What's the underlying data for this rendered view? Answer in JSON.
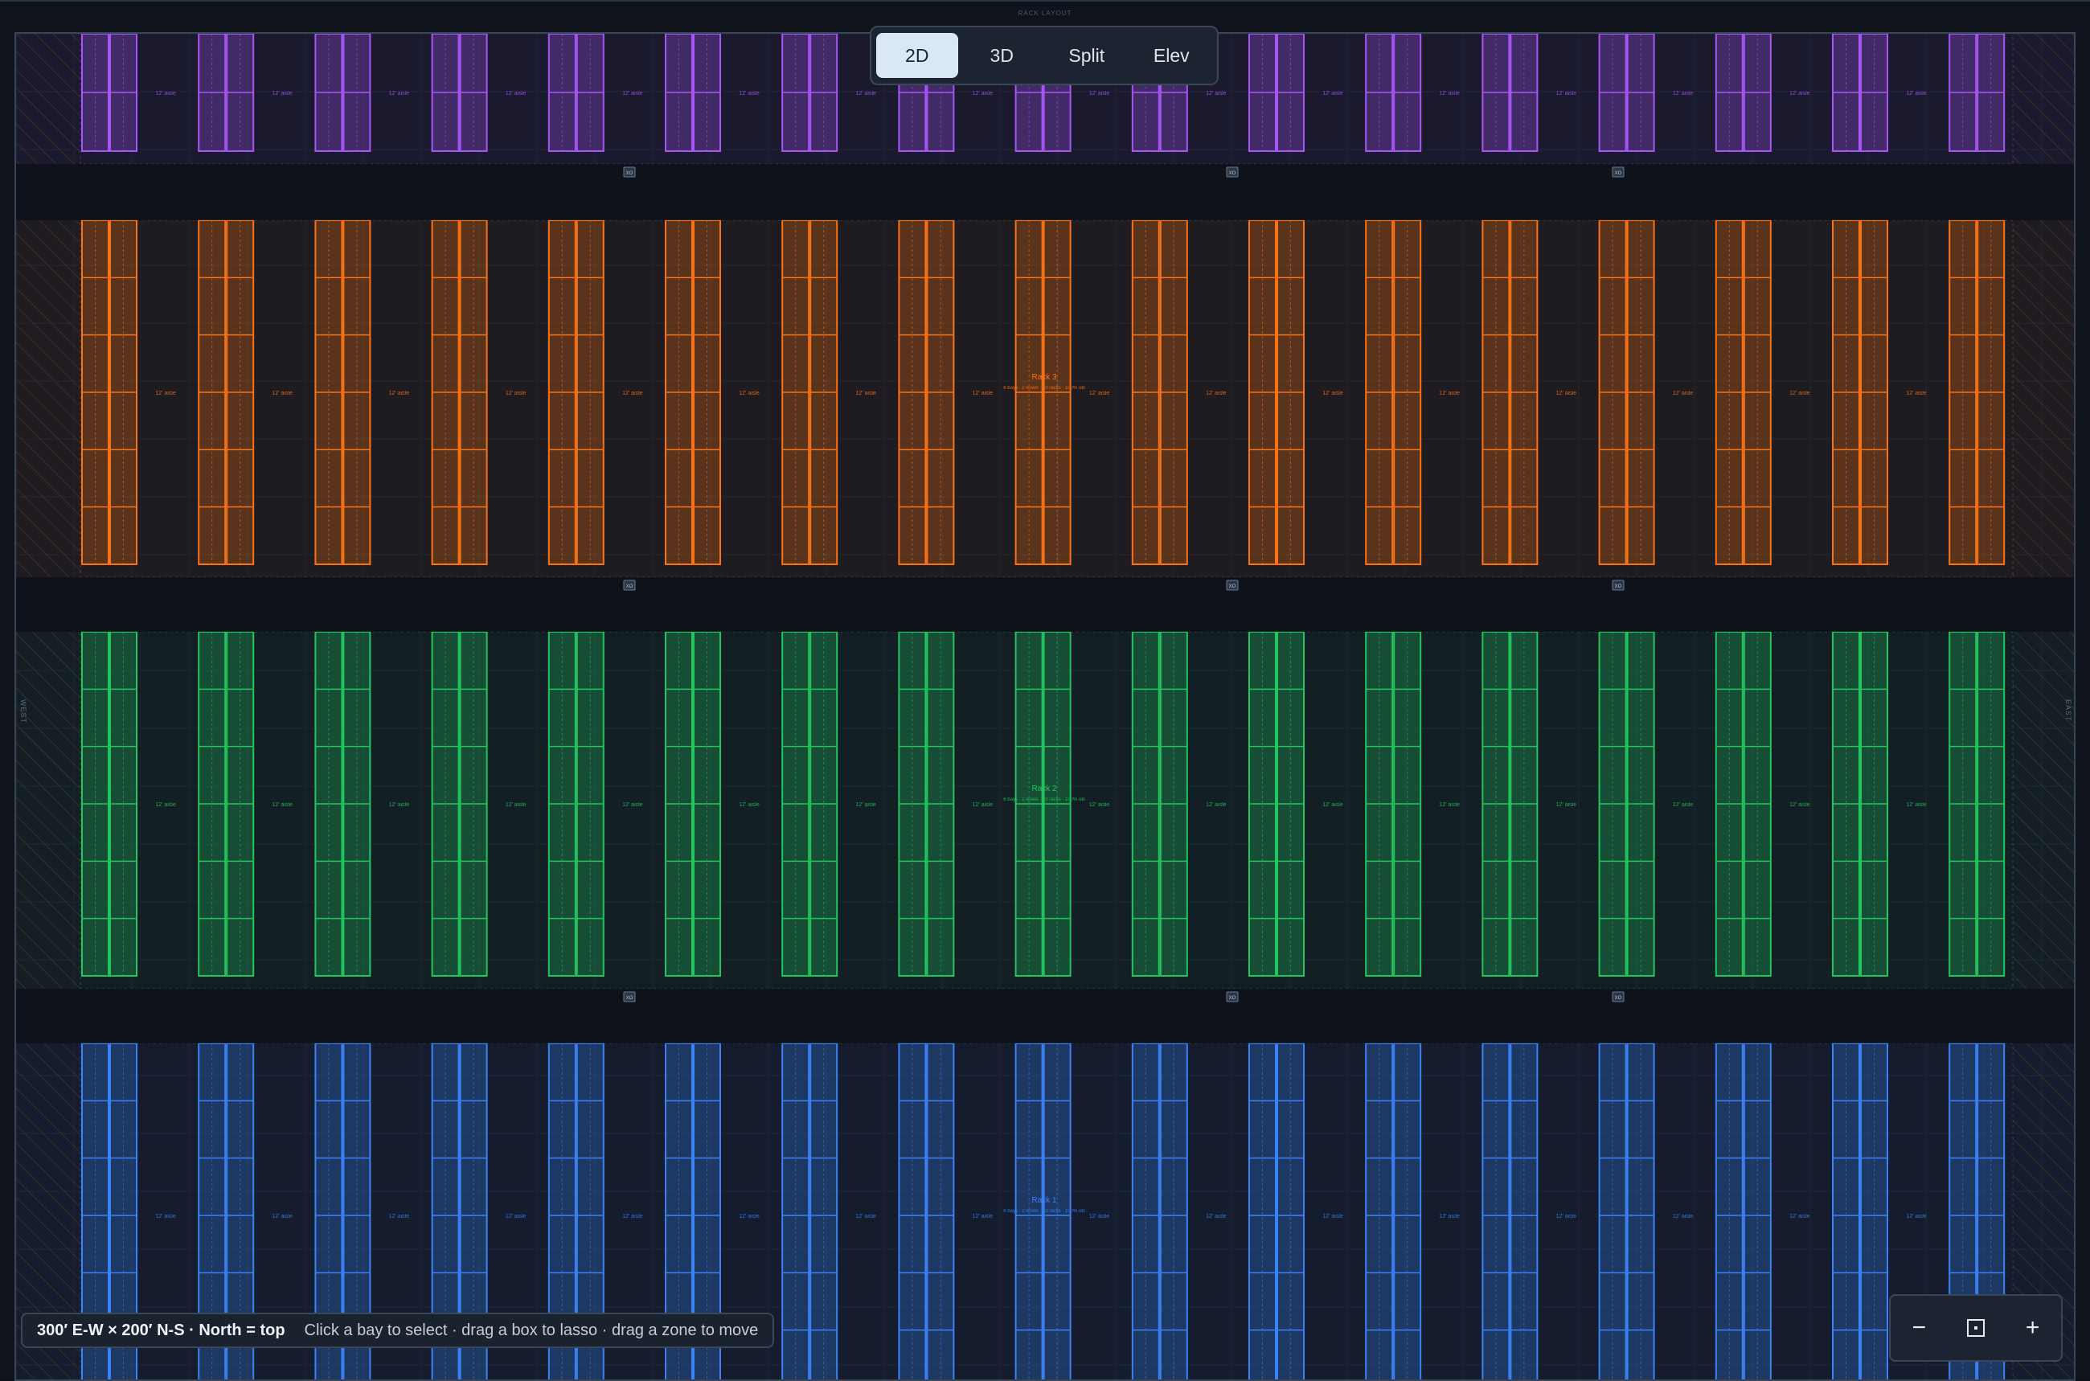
{
  "window": {
    "title": "RACK LAYOUT"
  },
  "view_toggle": {
    "options": [
      {
        "id": "2d",
        "label": "2D",
        "active": true
      },
      {
        "id": "3d",
        "label": "3D",
        "active": false
      },
      {
        "id": "split",
        "label": "Split",
        "active": false
      },
      {
        "id": "elev",
        "label": "Elev",
        "active": false
      }
    ]
  },
  "walls": {
    "west": "WEST",
    "east": "EAST"
  },
  "zones": [
    {
      "id": "rack-4",
      "label": "",
      "color": "#a855f7",
      "cells_per_rack": 2,
      "aisle_label": "12' aisle",
      "info": ""
    },
    {
      "id": "rack-3",
      "label": "Rack 3",
      "color": "#f97316",
      "cells_per_rack": 6,
      "aisle_label": "12' aisle",
      "info": "6 bays · 2 levels · 10 racks · 100% util"
    },
    {
      "id": "rack-2",
      "label": "Rack 2",
      "color": "#22c55e",
      "cells_per_rack": 6,
      "aisle_label": "12' aisle",
      "info": "6 bays · 2 levels · 10 racks · 100% util"
    },
    {
      "id": "rack-1",
      "label": "Rack 1",
      "color": "#3b82f6",
      "cells_per_rack": 6,
      "aisle_label": "12' aisle",
      "info": "6 bays · 2 levels · 10 racks · 100% util"
    }
  ],
  "rack_pairs_per_zone": 17,
  "crossover_badge": "XO",
  "status": {
    "dims": "300′ E-W × 200′ N-S · North = top",
    "hint": "Click a bay to select · drag a box to lasso · drag a zone to move"
  },
  "zoom": {
    "out_label": "−",
    "in_label": "+",
    "fit_icon": "fit-to-screen-icon"
  }
}
